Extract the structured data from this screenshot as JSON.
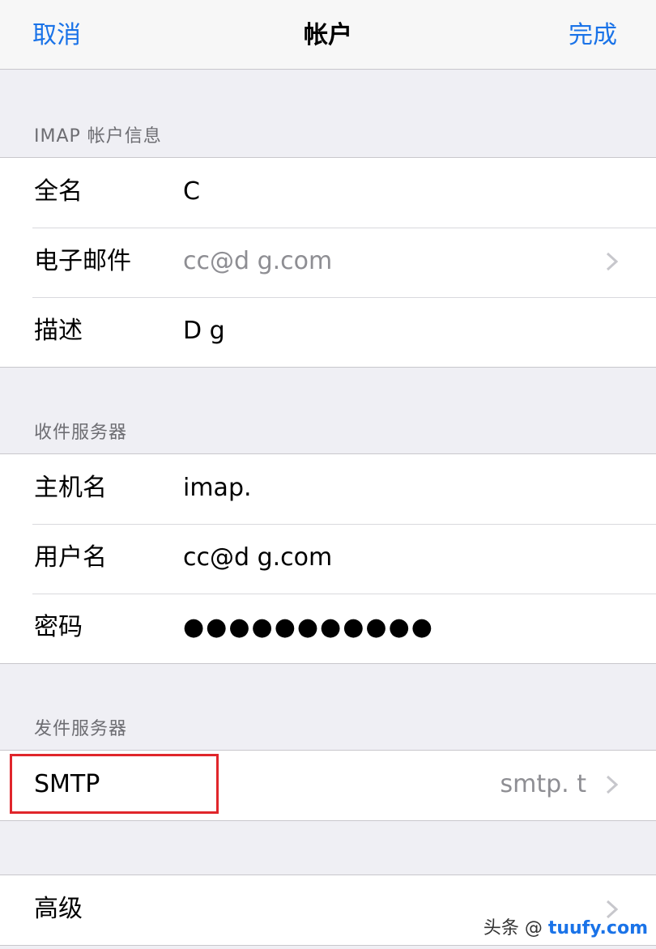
{
  "navbar": {
    "cancel": "取消",
    "title": "帐户",
    "done": "完成"
  },
  "sections": {
    "imap_header": "IMAP 帐户信息",
    "incoming_header": "收件服务器",
    "outgoing_header": "发件服务器"
  },
  "imap_account": {
    "full_name": {
      "label": "全名",
      "value": "C"
    },
    "email": {
      "label": "电子邮件",
      "value": "cc@d g.com"
    },
    "description": {
      "label": "描述",
      "value": "D g"
    }
  },
  "incoming_server": {
    "host": {
      "label": "主机名",
      "value": "imap."
    },
    "username": {
      "label": "用户名",
      "value": "cc@d g.com"
    },
    "password": {
      "label": "密码",
      "value": "●●●●●●●●●●●"
    }
  },
  "outgoing_server": {
    "smtp": {
      "label": "SMTP",
      "value": "smtp. t"
    }
  },
  "advanced": {
    "label": "高级"
  },
  "watermark": {
    "prefix": "头条 @",
    "brand": "tuufy.com"
  },
  "colors": {
    "accent": "#1a73e8",
    "highlight_box": "#e0262b"
  }
}
